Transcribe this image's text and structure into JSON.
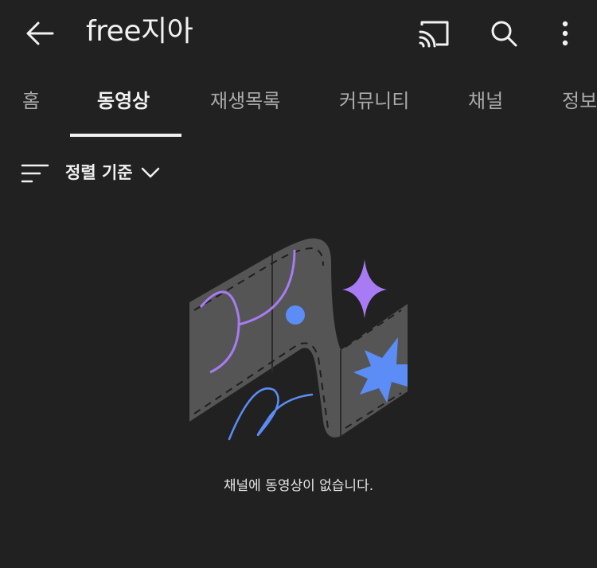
{
  "header": {
    "title": "free지아",
    "back_icon": "arrow-left-icon",
    "cast_icon": "cast-icon",
    "search_icon": "search-icon",
    "more_icon": "more-vertical-icon"
  },
  "tabs": [
    {
      "label": "홈",
      "active": false
    },
    {
      "label": "동영상",
      "active": true
    },
    {
      "label": "재생목록",
      "active": false
    },
    {
      "label": "커뮤니티",
      "active": false
    },
    {
      "label": "채널",
      "active": false
    },
    {
      "label": "정보",
      "active": false
    }
  ],
  "sort": {
    "label": "정렬 기준",
    "icon": "sort-icon",
    "chevron": "chevron-down-icon"
  },
  "empty_state": {
    "message": "채널에 동영상이 없습니다."
  },
  "colors": {
    "background": "#212121",
    "text": "#f1f1f1",
    "inactive_tab": "#aaaaaa",
    "illustration_purple": "#a77bf3",
    "illustration_blue": "#5c8df6",
    "illustration_gray": "#5a5a5a"
  }
}
